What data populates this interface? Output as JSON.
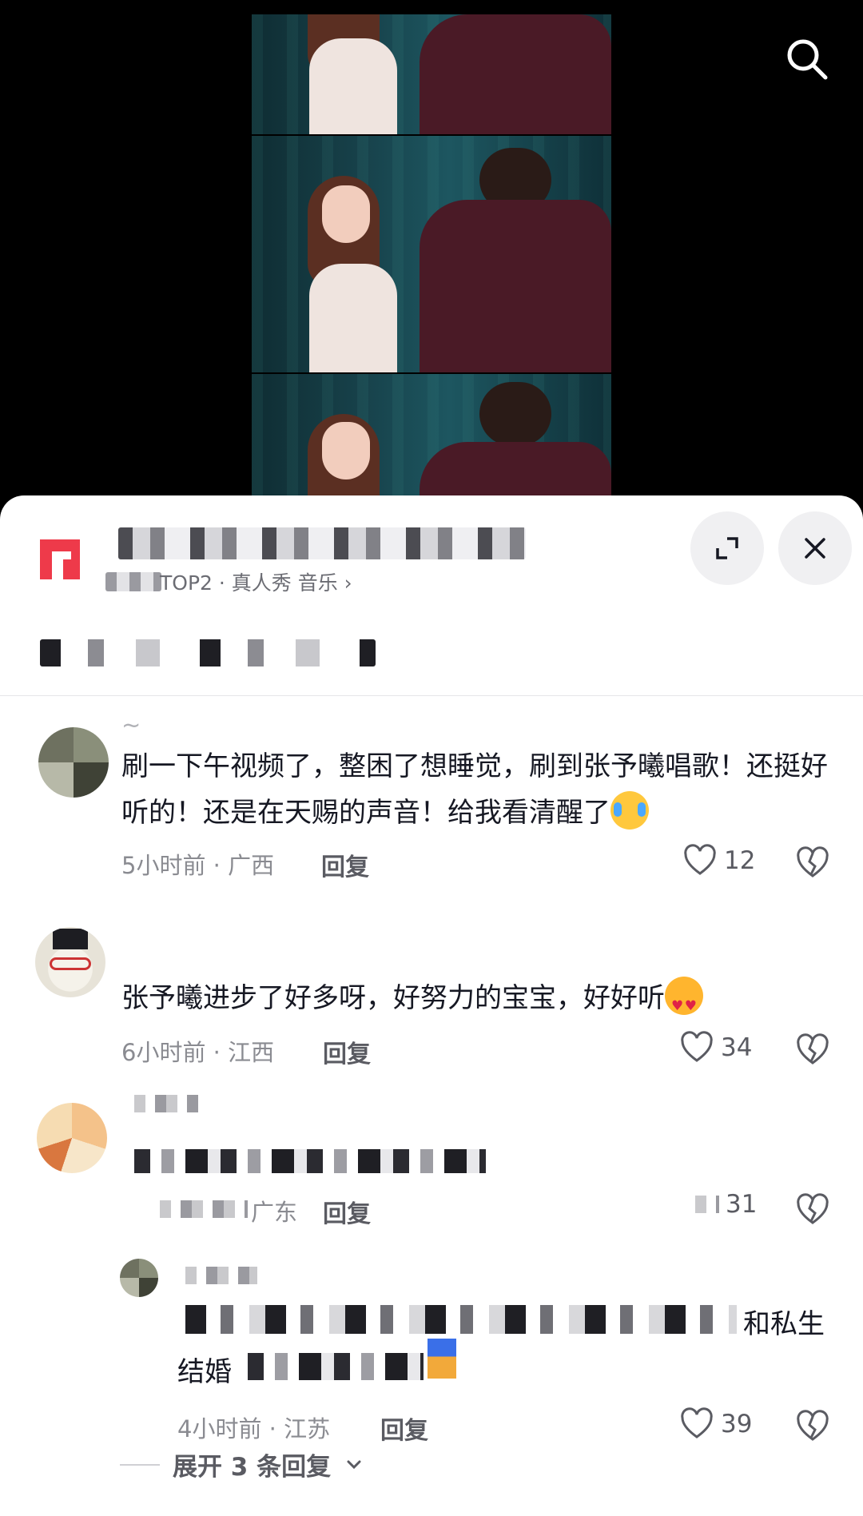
{
  "account": {
    "tag_text": "TOP2 · 真人秀 音乐 ›"
  },
  "comments": [
    {
      "text": "刷一下午视频了，整困了想睡觉，刷到张予曦唱歌！还挺好听的！还是在天赐的声音！给我看清醒了",
      "nickname": "~",
      "meta": "5小时前 · 广西",
      "reply_label": "回复",
      "likes": "12"
    },
    {
      "text": "张予曦进步了好多呀，好努力的宝宝，好好听",
      "meta": "6小时前 · 江西",
      "reply_label": "回复",
      "likes": "34"
    },
    {
      "meta": "广东",
      "reply_label": "回复",
      "likes": "31"
    }
  ],
  "reply": {
    "text_visible_end": "和私生",
    "text_visible_start": "结婚",
    "meta": "4小时前 · 江苏",
    "reply_label": "回复",
    "likes": "39"
  },
  "expand": {
    "label": "展开 3 条回复"
  },
  "colors": {
    "logo": "#ee3a4a",
    "sheet_bg": "#ffffff",
    "secondary_text": "#8a8b91"
  }
}
